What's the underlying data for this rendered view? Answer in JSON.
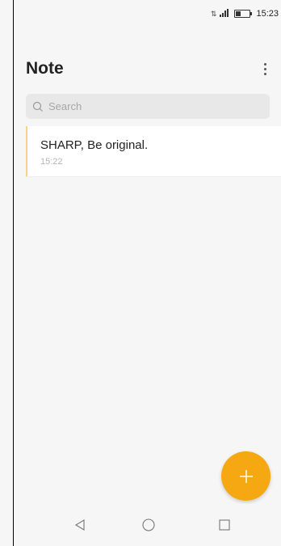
{
  "status_bar": {
    "network_icon": "data-arrows-icon",
    "signal_icon": "signal-icon",
    "battery_icon": "battery-icon",
    "time": "15:23"
  },
  "header": {
    "title": "Note",
    "menu_icon": "more-vertical-icon"
  },
  "search": {
    "icon": "search-icon",
    "placeholder": "Search"
  },
  "notes": [
    {
      "title": "SHARP, Be original.",
      "time": "15:22"
    }
  ],
  "fab": {
    "icon": "plus-icon",
    "color": "#f5a812"
  },
  "nav_bar": {
    "back_icon": "back-triangle-icon",
    "home_icon": "home-circle-icon",
    "recents_icon": "recents-square-icon"
  },
  "colors": {
    "accent": "#f5a812",
    "note_accent": "#f5d48a",
    "background": "#f6f6f6"
  }
}
